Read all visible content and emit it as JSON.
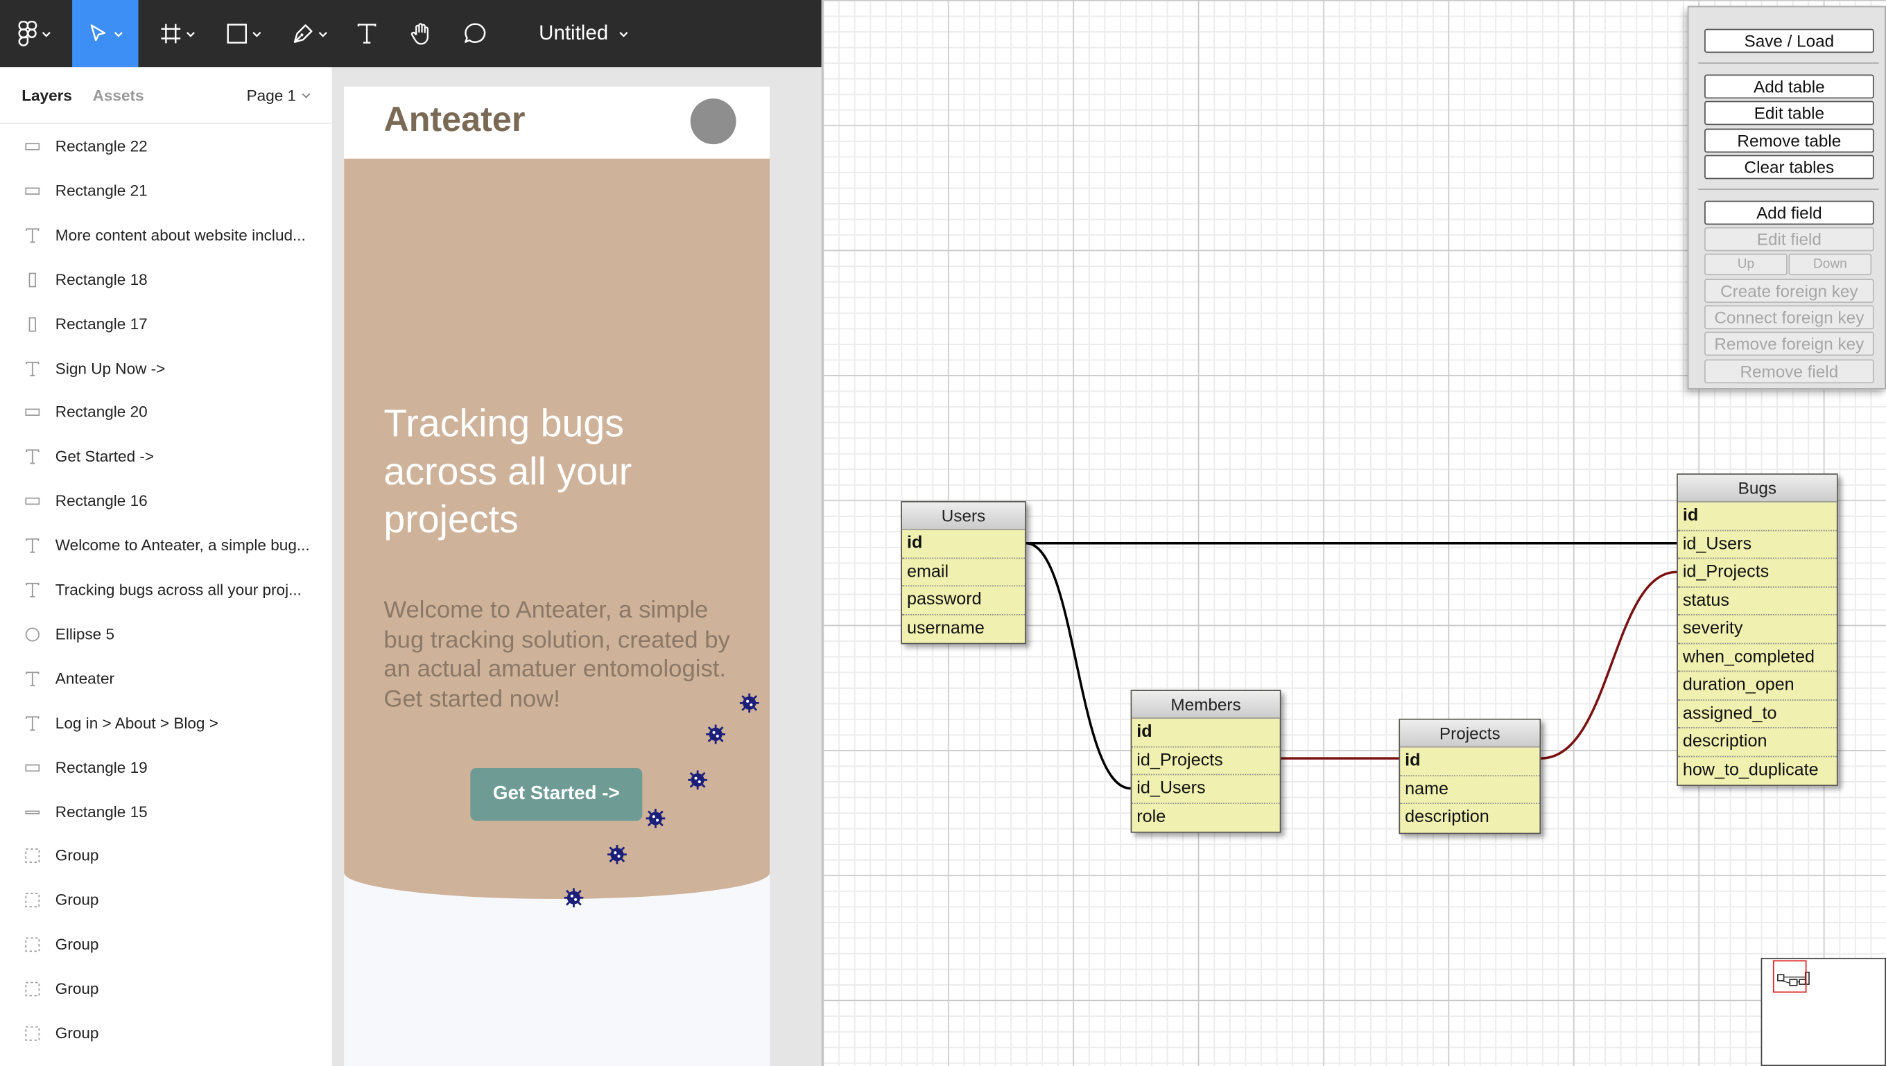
{
  "figma": {
    "doc_title": "Untitled",
    "sidebar_tabs": [
      "Layers",
      "Assets"
    ],
    "page": "Page 1",
    "layers": [
      {
        "name": "Rectangle 22",
        "icon": "rect-h"
      },
      {
        "name": "Rectangle 21",
        "icon": "rect-h"
      },
      {
        "name": "More content about website includ...",
        "icon": "text"
      },
      {
        "name": "Rectangle 18",
        "icon": "rect-v"
      },
      {
        "name": "Rectangle 17",
        "icon": "rect-v"
      },
      {
        "name": "Sign Up Now ->",
        "icon": "text"
      },
      {
        "name": "Rectangle 20",
        "icon": "rect-h"
      },
      {
        "name": "Get Started ->",
        "icon": "text"
      },
      {
        "name": "Rectangle 16",
        "icon": "rect-h"
      },
      {
        "name": "Welcome to Anteater, a simple bug...",
        "icon": "text"
      },
      {
        "name": "Tracking bugs across all your proj...",
        "icon": "text"
      },
      {
        "name": "Ellipse 5",
        "icon": "ellipse"
      },
      {
        "name": "Anteater",
        "icon": "text"
      },
      {
        "name": "Log in > About > Blog >",
        "icon": "text"
      },
      {
        "name": "Rectangle 19",
        "icon": "rect-h"
      },
      {
        "name": "Rectangle 15",
        "icon": "line"
      },
      {
        "name": "Group",
        "icon": "group"
      },
      {
        "name": "Group",
        "icon": "group"
      },
      {
        "name": "Group",
        "icon": "group"
      },
      {
        "name": "Group",
        "icon": "group"
      },
      {
        "name": "Group",
        "icon": "group"
      }
    ],
    "mockup": {
      "brand": "Anteater",
      "hero_title": "Tracking bugs across all your projects",
      "hero_sub": "Welcome to Anteater, a simple bug tracking solution, created by an actual amatuer entomologist. Get started now!",
      "cta": "Get Started ->",
      "colors": {
        "hero": "#cfb29a",
        "cta": "#6e9c95",
        "brand": "#7a6a55",
        "bug": "#1c1f7a"
      }
    }
  },
  "erd": {
    "panel": {
      "save_load": "Save / Load",
      "add_table": "Add table",
      "edit_table": "Edit table",
      "remove_table": "Remove table",
      "clear_tables": "Clear tables",
      "add_field": "Add field",
      "edit_field": "Edit field",
      "up": "Up",
      "down": "Down",
      "create_fk": "Create foreign key",
      "connect_fk": "Connect foreign key",
      "remove_fk": "Remove foreign key",
      "remove_field": "Remove field"
    },
    "tables": {
      "users": {
        "title": "Users",
        "fields": [
          "id",
          "email",
          "password",
          "username"
        ]
      },
      "members": {
        "title": "Members",
        "fields": [
          "id",
          "id_Projects",
          "id_Users",
          "role"
        ]
      },
      "projects": {
        "title": "Projects",
        "fields": [
          "id",
          "name",
          "description"
        ]
      },
      "bugs": {
        "title": "Bugs",
        "fields": [
          "id",
          "id_Users",
          "id_Projects",
          "status",
          "severity",
          "when_completed",
          "duration_open",
          "assigned_to",
          "description",
          "how_to_duplicate"
        ]
      }
    },
    "link_colors": {
      "users": "#000000",
      "projects": "#7a1010"
    }
  }
}
